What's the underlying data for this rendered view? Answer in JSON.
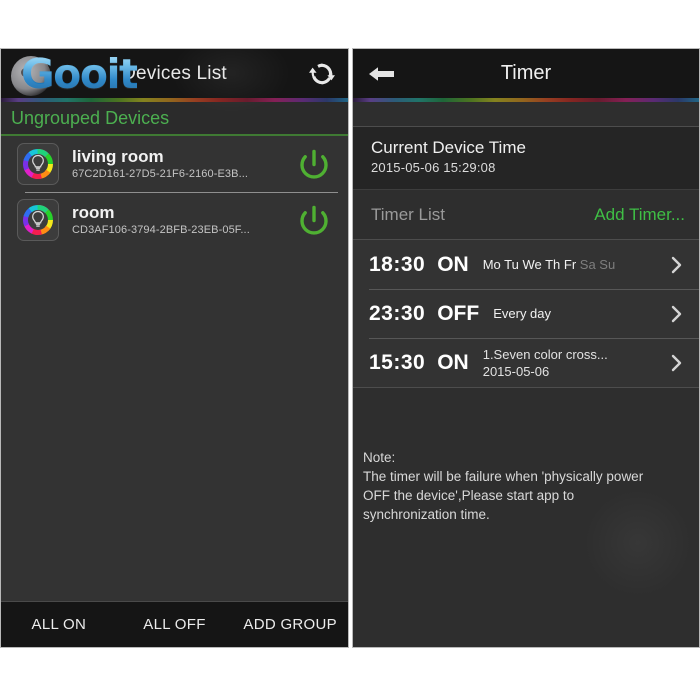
{
  "left_panel": {
    "titlebar": {
      "title": "Devices List",
      "logo_text": "Gooit",
      "refresh_icon": "refresh-sync-icon"
    },
    "group_header": {
      "label": "Ungrouped Devices"
    },
    "devices": [
      {
        "name": "living room",
        "uuid": "67C2D161-27D5-21F6-2160-E3B...",
        "icon": "rgb-color-wheel-bulb-icon",
        "power_icon": "power-icon",
        "power_color": "#4fb032"
      },
      {
        "name": "room",
        "uuid": "CD3AF106-3794-2BFB-23EB-05F...",
        "icon": "rgb-color-wheel-bulb-icon",
        "power_icon": "power-icon",
        "power_color": "#4fb032"
      }
    ],
    "bottom_bar": {
      "all_on": "ALL ON",
      "all_off": "ALL OFF",
      "add_group": "ADD GROUP"
    }
  },
  "right_panel": {
    "titlebar": {
      "title": "Timer",
      "back_icon": "back-arrow-icon"
    },
    "device_time": {
      "label": "Current Device Time",
      "value": "2015-05-06 15:29:08"
    },
    "timer_list_header": {
      "label": "Timer List",
      "add_label": "Add Timer..."
    },
    "timers": [
      {
        "time": "18:30",
        "state": "ON",
        "days_active": "Mo Tu We Th Fr",
        "days_inactive": "Sa Su",
        "line2": "",
        "chevron": "chevron-right-icon"
      },
      {
        "time": "23:30",
        "state": "OFF",
        "days_active": "Every day",
        "days_inactive": "",
        "line2": "",
        "chevron": "chevron-right-icon"
      },
      {
        "time": "15:30",
        "state": "ON",
        "days_active": "1.Seven color cross...",
        "days_inactive": "",
        "line2": "2015-05-06",
        "chevron": "chevron-right-icon"
      }
    ],
    "note": {
      "title": "Note:",
      "line1": "The timer will be failure when 'physically power",
      "line2": "OFF the device',Please start app to",
      "line3": "synchronization time."
    }
  },
  "colors": {
    "accent_green": "#4caf50",
    "add_timer_green": "#3fbf45",
    "power_green": "#4fb032",
    "panel_bg": "#2e2e2e",
    "row_bg": "#333333",
    "titlebar_bg": "#151515",
    "logo_blue": "#2f8fd0"
  }
}
